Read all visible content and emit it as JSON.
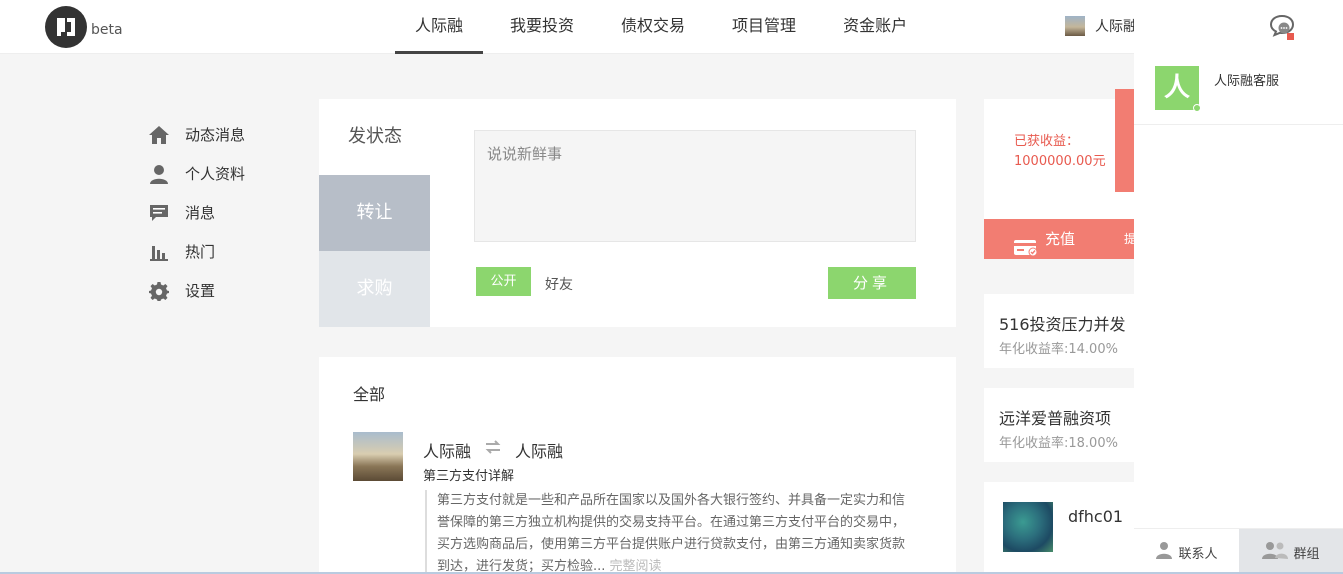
{
  "header": {
    "beta": "beta",
    "nav": [
      "人际融",
      "我要投资",
      "债权交易",
      "项目管理",
      "资金账户"
    ],
    "user_name": "人际融"
  },
  "sidebar": {
    "items": [
      {
        "label": "动态消息",
        "icon": "home-icon"
      },
      {
        "label": "个人资料",
        "icon": "person-icon"
      },
      {
        "label": "消息",
        "icon": "message-icon"
      },
      {
        "label": "热门",
        "icon": "bar-chart-icon"
      },
      {
        "label": "设置",
        "icon": "gear-icon"
      }
    ]
  },
  "post": {
    "tabs": [
      "发状态",
      "转让",
      "求购"
    ],
    "placeholder": "说说新鲜事",
    "public_label": "公开",
    "friends_label": "好友",
    "share_label": "分享"
  },
  "feed": {
    "title": "全部",
    "item": {
      "user": "人际融",
      "repost_user": "人际融",
      "subtitle": "第三方支付详解",
      "body": "第三方支付就是一些和产品所在国家以及国外各大银行签约、并具备一定实力和信誉保障的第三方独立机构提供的交易支持平台。在通过第三方支付平台的交易中，买方选购商品后，使用第三方平台提供账户进行贷款支付，由第三方通知卖家货款到达，进行发货；买方检验...",
      "read_more": "完整阅读"
    }
  },
  "earnings": {
    "label": "已获收益：",
    "amount": "1000000.00元",
    "recharge_label": "充值",
    "recharge_extra": "提"
  },
  "projects": [
    {
      "name": "516投资压力并发",
      "rate": "年化收益率:14.00%"
    },
    {
      "name": "远洋爱普融资项",
      "rate": "年化收益率:18.00%"
    }
  ],
  "member": {
    "name": "dfhc01"
  },
  "chat": {
    "contact_initial": "人",
    "contact_name": "人际融客服",
    "footer": [
      {
        "label": "联系人",
        "icon": "contact-icon"
      },
      {
        "label": "群组",
        "icon": "group-icon"
      }
    ]
  },
  "colors": {
    "accent_green": "#8cd66e",
    "accent_red": "#f27d72",
    "tab_gray": "#b7bec8"
  }
}
